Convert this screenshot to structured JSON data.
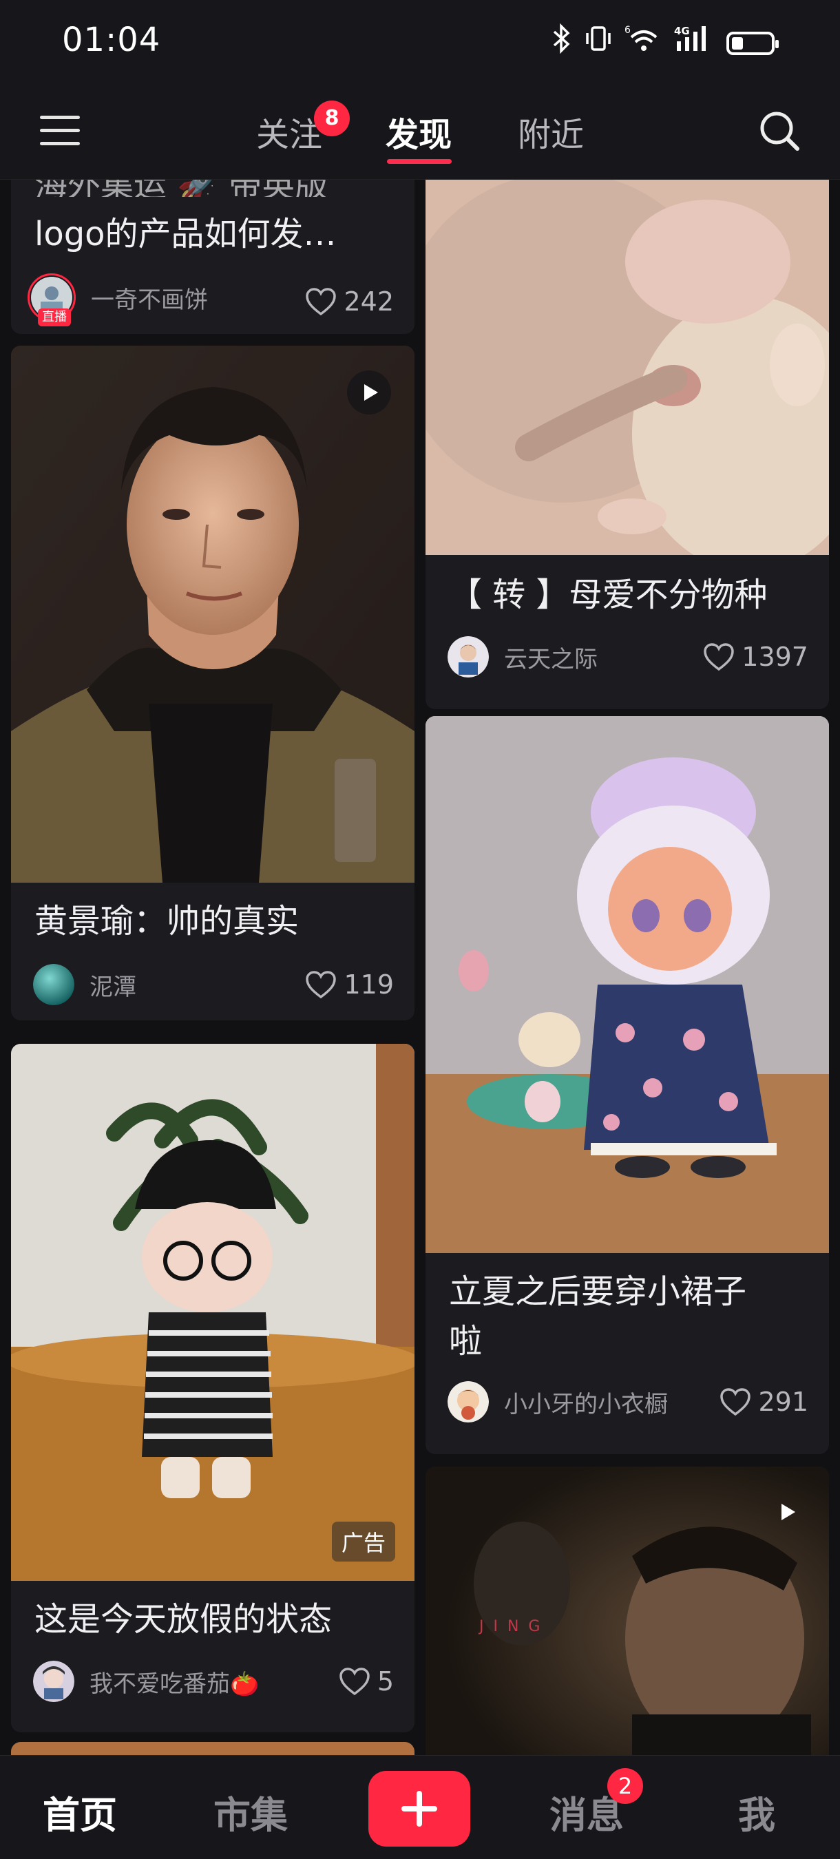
{
  "status_bar": {
    "time": "01:04",
    "network_label": "4G",
    "sim_label": "6",
    "battery_level": 0.3
  },
  "top_nav": {
    "tabs": [
      {
        "label": "关注",
        "badge": "8"
      },
      {
        "label": "发现",
        "active": true
      },
      {
        "label": "附近"
      }
    ],
    "icons": [
      "menu-icon",
      "search-icon"
    ]
  },
  "feed": {
    "cards": [
      {
        "title": "海外集运 🚀 带英版 logo的产品如何发…",
        "title_visible": "logo的产品如何发…",
        "author": "一奇不画饼",
        "author_live_tag": "直播",
        "likes": "242"
      },
      {
        "title": "【 转 】母爱不分物种",
        "author": "云天之际",
        "likes": "1397"
      },
      {
        "title": "黄景瑜：帅的真实",
        "author": "泥潭",
        "likes": "119",
        "is_video": true
      },
      {
        "title": "立夏之后要穿小裙子啦",
        "title_line1": "立夏之后要穿小裙子",
        "title_line2": "啦",
        "author": "小小牙的小衣橱",
        "likes": "291"
      },
      {
        "title": "这是今天放假的状态",
        "author": "我不爱吃番茄🍅",
        "likes": "5",
        "ad_label": "广告"
      },
      {
        "overlay_text": "JING",
        "is_video": true
      }
    ]
  },
  "bottom_nav": {
    "items": [
      {
        "label": "首页",
        "active": true
      },
      {
        "label": "市集"
      },
      {
        "label": "消息",
        "badge": "2"
      },
      {
        "label": "我"
      }
    ],
    "add_icon": "plus-icon"
  },
  "colors": {
    "accent": "#ff2742",
    "background": "#111114",
    "card": "#1c1c20"
  }
}
